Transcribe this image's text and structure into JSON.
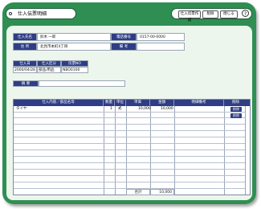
{
  "window": {
    "title": "仕入伝票明細"
  },
  "toolbar": {
    "print_label": "仕入伝票作成",
    "delete_label": "削除",
    "close_label": "閉じる",
    "help_label": "?"
  },
  "header": {
    "supplier_label": "仕入先名",
    "supplier_value": "鈴木 一郎",
    "phone_label": "電話番号",
    "phone_value": "0157-00-0000",
    "address_label": "住 所",
    "address_value": "北見市本町4丁目",
    "remarks_label": "備 考",
    "remarks_value": ""
  },
  "slip": {
    "date_label": "仕入日",
    "date_value": "2000/04/26",
    "category_label": "仕入区分",
    "category_value": "部品/用品",
    "slip_no_label": "伝票NO",
    "slip_no_value": "NBO0100"
  },
  "summary": {
    "label": "摘 要",
    "value": ""
  },
  "table": {
    "columns": [
      "仕入内容／部品名等",
      "数量",
      "単位",
      "単価",
      "金額",
      "明細備考",
      "削除"
    ],
    "rows": [
      {
        "item": "タイヤ",
        "qty": "1",
        "unit": "式",
        "price": "10,000",
        "amount": "10,000",
        "note": ""
      }
    ],
    "delete_buttons": [
      "削除",
      "削除"
    ],
    "total_label": "合計",
    "total_value": "10,000"
  }
}
